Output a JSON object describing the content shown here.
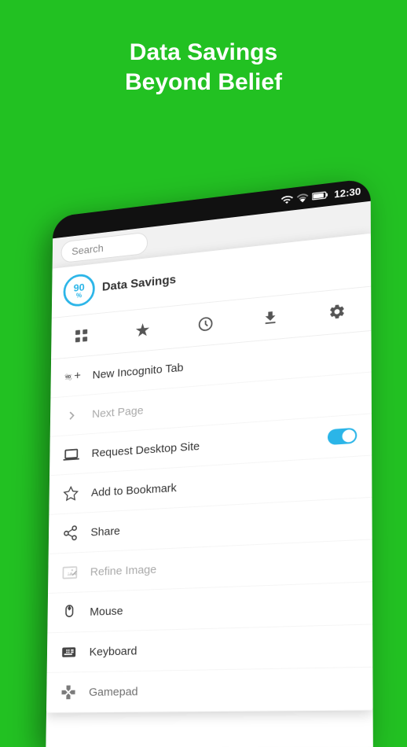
{
  "header": {
    "line1": "Data Savings",
    "line2": "Beyond Belief"
  },
  "status_bar": {
    "time": "12:30"
  },
  "search": {
    "placeholder": "Search"
  },
  "panel": {
    "savings_percent": "90",
    "savings_percent_symbol": "%",
    "savings_title": "Data Savings",
    "toolbar": {
      "tabs_icon": "⊞",
      "bookmarks_icon": "★",
      "history_icon": "🕐",
      "downloads_icon": "⬇",
      "settings_icon": "⚙"
    },
    "menu_items": [
      {
        "id": "new-incognito-tab",
        "label": "New Incognito Tab",
        "icon": "incognito",
        "disabled": false
      },
      {
        "id": "next-page",
        "label": "Next Page",
        "icon": "chevron-right",
        "disabled": true
      },
      {
        "id": "request-desktop",
        "label": "Request Desktop Site",
        "icon": "desktop",
        "disabled": false,
        "toggle": true
      },
      {
        "id": "add-bookmark",
        "label": "Add to Bookmark",
        "icon": "star-outline",
        "disabled": false
      },
      {
        "id": "share",
        "label": "Share",
        "icon": "share",
        "disabled": false
      },
      {
        "id": "refine-image",
        "label": "Refine Image",
        "icon": "image-edit",
        "disabled": true
      },
      {
        "id": "mouse",
        "label": "Mouse",
        "icon": "mouse",
        "disabled": false
      },
      {
        "id": "keyboard",
        "label": "Keyboard",
        "icon": "keyboard",
        "disabled": false
      },
      {
        "id": "gamepad",
        "label": "Gamepad",
        "icon": "gamepad",
        "disabled": false
      }
    ]
  },
  "colors": {
    "green_bg": "#22c122",
    "accent_blue": "#2bb5e8",
    "text_dark": "#333333",
    "text_disabled": "#aaaaaa"
  }
}
